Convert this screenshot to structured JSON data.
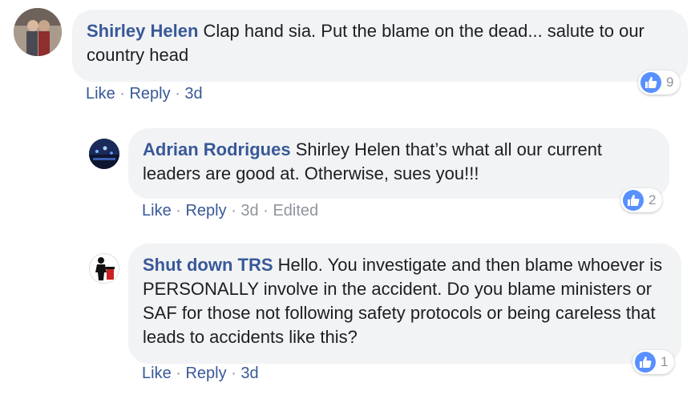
{
  "comments": [
    {
      "author": "Shirley Helen",
      "text": "Clap hand sia. Put the blame on the dead... salute to our country head",
      "like_label": "Like",
      "reply_label": "Reply",
      "time": "3d",
      "edited": "",
      "reaction_count": "9"
    },
    {
      "author": "Adrian Rodrigues",
      "text": "Shirley Helen that’s what all our current leaders are good at. Otherwise, sues you!!!",
      "like_label": "Like",
      "reply_label": "Reply",
      "time": "3d",
      "edited": "Edited",
      "reaction_count": "2"
    },
    {
      "author": "Shut down TRS",
      "text": "Hello. You investigate and then blame whoever is PERSONALLY involve in the accident. Do you blame ministers or SAF for those not following safety protocols or being careless that leads to accidents like this?",
      "like_label": "Like",
      "reply_label": "Reply",
      "time": "3d",
      "edited": "",
      "reaction_count": "1"
    }
  ],
  "colors": {
    "author": "#385898",
    "bubble": "#f2f3f5",
    "like_blue": "#5890ff",
    "meta_gray": "#90949c"
  },
  "icons": [
    "avatar-photo",
    "like-icon"
  ]
}
